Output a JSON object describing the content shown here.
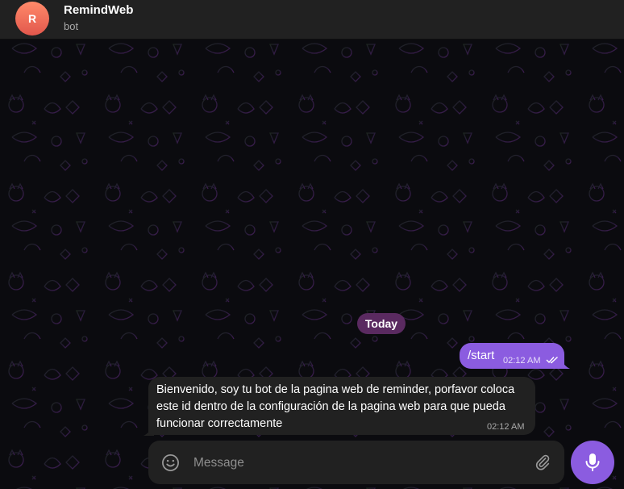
{
  "header": {
    "avatar_letter": "R",
    "title": "RemindWeb",
    "subtitle": "bot"
  },
  "messages": {
    "date_label": "Today",
    "outgoing": {
      "text": "/start",
      "time": "02:12 AM",
      "status_icon": "double-check-icon"
    },
    "incoming": {
      "text": "Bienvenido, soy tu bot de la pagina web de reminder, porfavor coloca este id dentro de la configuración de la pagina web para que pueda funcionar correctamente",
      "time": "02:12 AM"
    }
  },
  "composer": {
    "placeholder": "Message",
    "icons": [
      "emoji-icon",
      "paperclip-icon",
      "microphone-icon"
    ]
  },
  "colors": {
    "accent": "#8b5ce0",
    "header_bg": "#212121",
    "incoming_bg": "#212121",
    "date_chip": "#5a2a60"
  }
}
